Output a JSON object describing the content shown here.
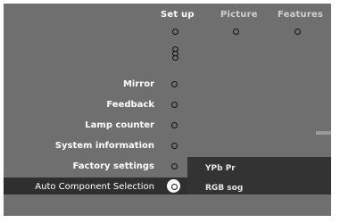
{
  "tabs": [
    {
      "label": "Set up"
    },
    {
      "label": "Picture"
    },
    {
      "label": "Features"
    }
  ],
  "menu_items": [
    {
      "label": "Mirror"
    },
    {
      "label": "Feedback"
    },
    {
      "label": "Lamp counter"
    },
    {
      "label": "System information"
    },
    {
      "label": "Factory settings"
    },
    {
      "label": "Auto Component Selection"
    }
  ],
  "submenu": {
    "items": [
      {
        "label": "YPb Pr"
      },
      {
        "label": "RGB sog"
      }
    ]
  },
  "selected_item": "Auto Component Selection"
}
